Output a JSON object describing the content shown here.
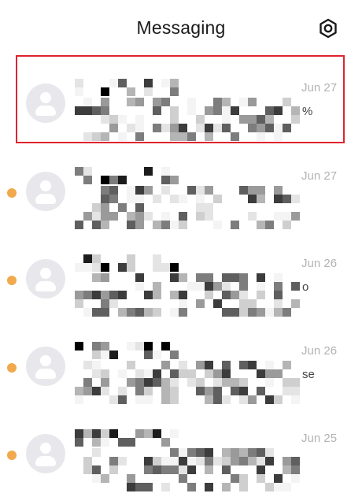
{
  "header": {
    "title": "Messaging",
    "settings_icon": "gear-icon"
  },
  "conversations": [
    {
      "date": "Jun 27",
      "preview_tail": "%",
      "unread": false,
      "selected": true
    },
    {
      "date": "Jun 27",
      "preview_tail": "",
      "unread": true,
      "selected": false
    },
    {
      "date": "Jun 26",
      "preview_tail": "o",
      "unread": true,
      "selected": false
    },
    {
      "date": "Jun 26",
      "preview_tail": "se",
      "unread": true,
      "selected": false
    },
    {
      "date": "Jun 25",
      "preview_tail": "",
      "unread": true,
      "selected": false
    }
  ],
  "colors": {
    "unread_dot": "#f0a94c",
    "selection_border": "#e0232f",
    "avatar_bg": "#e8e8ec",
    "date_text": "#b3b3b3"
  }
}
